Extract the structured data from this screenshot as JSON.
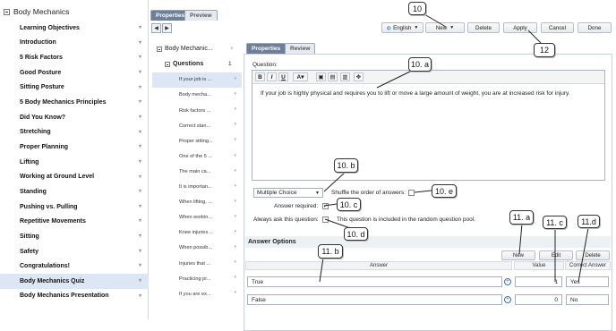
{
  "left_nav": {
    "title": "Body Mechanics",
    "items": [
      "Learning Objectives",
      "Introduction",
      "5 Risk Factors",
      "Good Posture",
      "Sitting Posture",
      "5 Body Mechanics Principles",
      "Did You Know?",
      "Stretching",
      "Proper Planning",
      "Lifting",
      "Working at Ground Level",
      "Standing",
      "Pushing vs. Pulling",
      "Repetitive Movements",
      "Sitting",
      "Safety",
      "Congratulations!",
      "Body Mechanics Quiz",
      "Body Mechanics Presentation"
    ],
    "selected_index": 17
  },
  "mid": {
    "tabs": [
      "Properties",
      "Preview"
    ],
    "root_label": "Body Mechanic...",
    "questions_label": "Questions",
    "questions_count": "1",
    "questions": [
      "If your job is ...",
      "Body mecha...",
      "Risk factors ...",
      "Correct stan...",
      "Proper sitting...",
      "One of the 5 ...",
      "The main ca...",
      "It is importan...",
      "When lifting, ...",
      "When workin...",
      "Knee injuries ...",
      "When possib...",
      "Injuries that ...",
      "Practicing pr...",
      "If you are ex..."
    ],
    "selected_index": 0
  },
  "toolbar": {
    "language": "English",
    "new": "New",
    "delete": "Delete",
    "apply": "Apply",
    "cancel": "Cancel",
    "done": "Done"
  },
  "panel": {
    "tabs": [
      "Properties",
      "Review"
    ],
    "question_label": "Question:",
    "question_text": "If your job is highly physical and requires you to lift or move a large amount of weight, you are at increased risk for injury.",
    "question_type": "Multiple Choice",
    "shuffle_label": "Shuffle the order of answers:",
    "answer_required_label": "Answer required:",
    "always_ask_label": "Always ask this question:",
    "pool_note": "This question is included in the random question pool.",
    "answer_options_label": "Answer Options",
    "buttons": {
      "new": "New",
      "edit": "Edit",
      "delete": "Delete"
    },
    "columns": [
      "Answer",
      "Value",
      "Correct Answer"
    ],
    "answers": [
      {
        "answer": "True",
        "value": "1",
        "correct": "Yes"
      },
      {
        "answer": "False",
        "value": "0",
        "correct": "No"
      }
    ]
  },
  "callouts": [
    "10",
    "10. a",
    "10. b",
    "10. c",
    "10. d",
    "10. e",
    "11. a",
    "11. b",
    "11. c",
    "11.d",
    "12"
  ]
}
